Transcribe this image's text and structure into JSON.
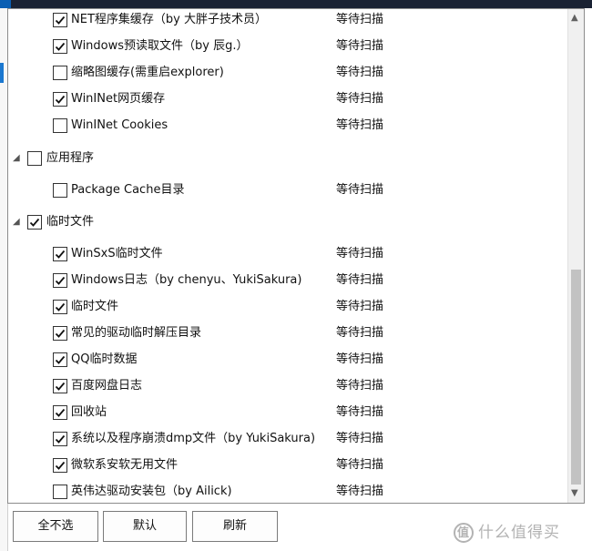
{
  "tree": [
    {
      "level": "child",
      "checked": true,
      "label": "NET程序集缓存（by 大胖子技术员）",
      "status": "等待扫描"
    },
    {
      "level": "child",
      "checked": true,
      "label": "Windows预读取文件（by 辰g.）",
      "status": "等待扫描"
    },
    {
      "level": "child",
      "checked": false,
      "label": "缩略图缓存(需重启explorer)",
      "status": "等待扫描"
    },
    {
      "level": "child",
      "checked": true,
      "label": "WinINet网页缓存",
      "status": "等待扫描"
    },
    {
      "level": "child",
      "checked": false,
      "label": "WinINet Cookies",
      "status": "等待扫描"
    },
    {
      "level": "group",
      "checked": false,
      "label": "应用程序",
      "status": ""
    },
    {
      "level": "child",
      "checked": false,
      "label": "Package Cache目录",
      "status": "等待扫描"
    },
    {
      "level": "group",
      "checked": true,
      "label": "临时文件",
      "status": ""
    },
    {
      "level": "child",
      "checked": true,
      "label": "WinSxS临时文件",
      "status": "等待扫描"
    },
    {
      "level": "child",
      "checked": true,
      "label": "Windows日志（by chenyu、YukiSakura)",
      "status": "等待扫描"
    },
    {
      "level": "child",
      "checked": true,
      "label": "临时文件",
      "status": "等待扫描"
    },
    {
      "level": "child",
      "checked": true,
      "label": "常见的驱动临时解压目录",
      "status": "等待扫描"
    },
    {
      "level": "child",
      "checked": true,
      "label": "QQ临时数据",
      "status": "等待扫描"
    },
    {
      "level": "child",
      "checked": true,
      "label": "百度网盘日志",
      "status": "等待扫描"
    },
    {
      "level": "child",
      "checked": true,
      "label": "回收站",
      "status": "等待扫描"
    },
    {
      "level": "child",
      "checked": true,
      "label": "系统以及程序崩溃dmp文件（by YukiSakura)",
      "status": "等待扫描"
    },
    {
      "level": "child",
      "checked": true,
      "label": "微软系安软无用文件",
      "status": "等待扫描"
    },
    {
      "level": "child",
      "checked": false,
      "label": "英伟达驱动安装包（by Ailick)",
      "status": "等待扫描"
    }
  ],
  "buttons": {
    "deselect_all": "全不选",
    "default": "默认",
    "refresh": "刷新"
  },
  "scrollbar": {
    "up_arrow": "▲",
    "down_arrow": "▼"
  },
  "icons": {
    "expanded_triangle": "◢"
  },
  "watermark": {
    "badge": "值",
    "text": "什么值得买"
  },
  "colors": {
    "accent": "#1b78d0",
    "topbar": "#1a2233",
    "scroll_thumb": "#c2c2c2"
  }
}
